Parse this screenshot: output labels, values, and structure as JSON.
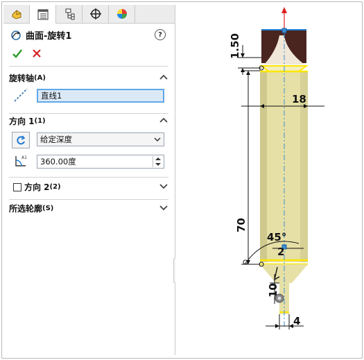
{
  "feature": {
    "title": "曲面-旋转1",
    "help_label": "?",
    "ok_icon": "check-icon",
    "cancel_icon": "x-icon"
  },
  "tabs": [
    {
      "name": "featuremanager",
      "icon": "feature-tree-icon"
    },
    {
      "name": "propertymanager",
      "icon": "property-list-icon"
    },
    {
      "name": "configurationmanager",
      "icon": "configuration-icon"
    },
    {
      "name": "dimxpert",
      "icon": "crosshair-icon"
    },
    {
      "name": "display",
      "icon": "appearance-pie-icon"
    }
  ],
  "sections": {
    "axis": {
      "title": "旋转轴",
      "suffix": "(A)",
      "value": "直线1"
    },
    "direction1": {
      "title": "方向 1",
      "suffix": "(1)",
      "end_condition": "给定深度",
      "angle": "360.00度"
    },
    "direction2": {
      "title": "方向 2",
      "suffix": "(2)",
      "checked": false
    },
    "profiles": {
      "title": "所选轮廓",
      "suffix": "(S)"
    }
  },
  "dimensions": {
    "d1": "1.50",
    "d2": "18",
    "d3": "70",
    "d4": "45°",
    "d5": "2",
    "d6": "10",
    "d7": "4"
  },
  "colors": {
    "body_fill": "#e8e3a8",
    "body_edge": "#ffe600",
    "axis_line": "#3b8fd1",
    "top_cap": "#5a2a22",
    "accent": "#2f8fd5"
  }
}
